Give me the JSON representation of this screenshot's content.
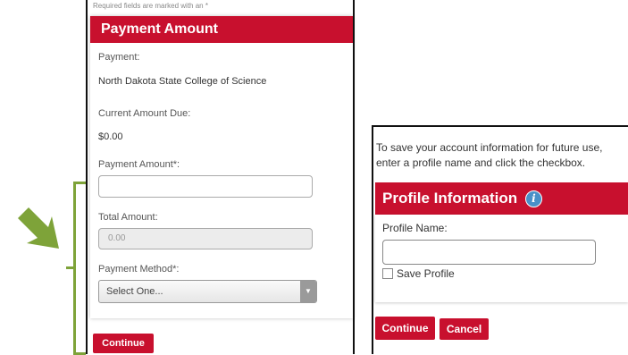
{
  "payment_form": {
    "required_note": "Required fields are marked with an *",
    "header": "Payment Amount",
    "payment_label": "Payment:",
    "payment_value": "North Dakota State College of Science",
    "current_due_label": "Current Amount Due:",
    "current_due_value": "$0.00",
    "payment_amount_label": "Payment Amount*:",
    "payment_amount_value": "",
    "total_amount_label": "Total Amount:",
    "total_amount_value": "0.00",
    "payment_method_label": "Payment Method*:",
    "payment_method_selected": "Select One...",
    "continue_label": "Continue"
  },
  "profile_form": {
    "instructions": "To save your account information for future use, enter a profile name and click the checkbox.",
    "header": "Profile Information",
    "info_icon": "i",
    "profile_name_label": "Profile Name:",
    "profile_name_value": "",
    "save_profile_label": "Save Profile",
    "continue_label": "Continue",
    "cancel_label": "Cancel"
  },
  "colors": {
    "brand_red": "#c8102e",
    "annotation_green": "#7ea339",
    "info_blue": "#4a90c8"
  },
  "icons": {
    "arrow_left": "green-arrow-icon",
    "arrow_right": "green-arrow-icon",
    "info": "info-icon",
    "select_caret": "chevron-down-icon"
  }
}
